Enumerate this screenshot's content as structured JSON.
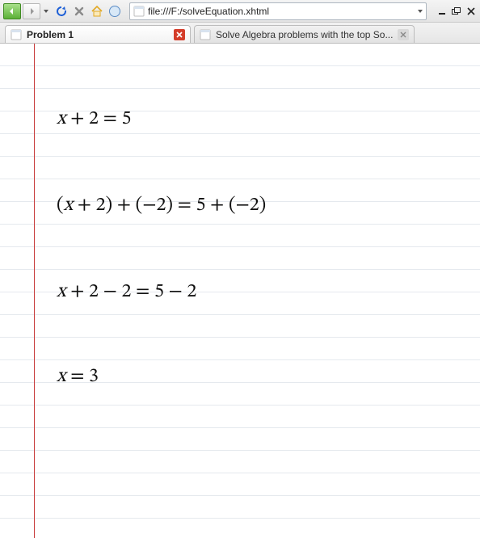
{
  "toolbar": {
    "url": "file:///F:/solveEquation.xhtml"
  },
  "tabs": [
    {
      "label": "Problem 1",
      "active": true
    },
    {
      "label": "Solve Algebra problems with the top So...",
      "active": false
    }
  ],
  "math": {
    "line1_a": "x",
    "line1_b": " + 2 = 5",
    "line2_a": "(",
    "line2_b": "x",
    "line2_c": " + 2) + (−2) = 5 + (−2)",
    "line3_a": "x",
    "line3_b": " + 2 − 2 = 5 − 2",
    "line4_a": "x",
    "line4_b": " = 3"
  }
}
